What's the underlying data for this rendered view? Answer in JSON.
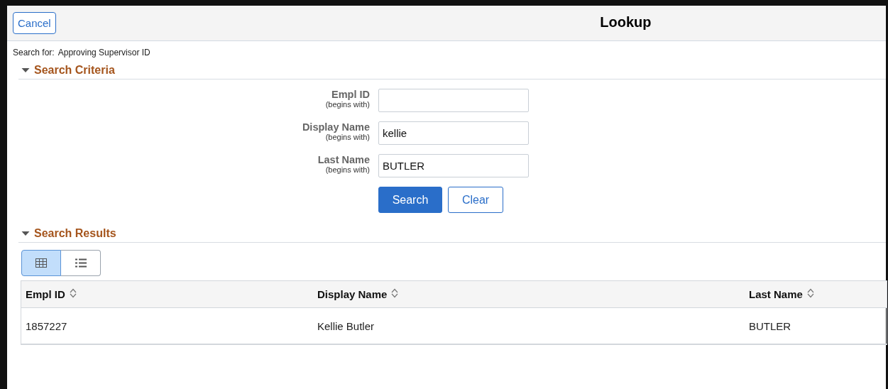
{
  "header": {
    "cancel": "Cancel",
    "title": "Lookup"
  },
  "search_for": {
    "label": "Search for:",
    "value": "Approving Supervisor ID"
  },
  "criteria": {
    "title": "Search Criteria",
    "expanded": true,
    "fields": [
      {
        "label": "Empl ID",
        "hint": "(begins with)"
      },
      {
        "label": "Display Name",
        "hint": "(begins with)",
        "value": "kellie"
      },
      {
        "label": "Last Name",
        "hint": "(begins with)",
        "value": "BUTLER"
      }
    ],
    "buttons": [
      {
        "label": "Search",
        "kind": "primary"
      },
      {
        "label": "Clear",
        "kind": "secondary"
      }
    ]
  },
  "results": {
    "title": "Search Results",
    "expanded": true,
    "views": [
      {
        "kind": "grid",
        "selected": true
      },
      {
        "kind": "list",
        "selected": false
      }
    ],
    "table": {
      "columns": [
        "Empl ID",
        "Display Name",
        "Last Name"
      ],
      "rows": [
        [
          "1857227",
          "Kellie Butler",
          "BUTLER"
        ]
      ]
    }
  }
}
